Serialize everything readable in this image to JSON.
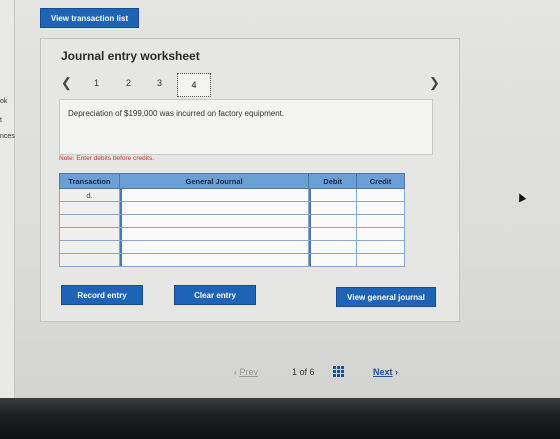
{
  "sidebar": {
    "fragments": [
      "ok",
      "t",
      "nces"
    ]
  },
  "toolbar": {
    "view_transactions_label": "View transaction list"
  },
  "worksheet": {
    "title": "Journal entry worksheet",
    "steps": [
      "1",
      "2",
      "3",
      "4"
    ],
    "active_step": "4",
    "prev_icon": "chevron-left",
    "next_icon": "chevron-right",
    "description": "Depreciation of $199,000 was incurred on factory equipment.",
    "note": "Note: Enter debits before credits.",
    "table": {
      "headers": [
        "Transaction",
        "General Journal",
        "Debit",
        "Credit"
      ],
      "rows": [
        {
          "transaction": "d."
        },
        {
          "transaction": ""
        },
        {
          "transaction": ""
        },
        {
          "transaction": ""
        },
        {
          "transaction": ""
        },
        {
          "transaction": ""
        }
      ]
    },
    "buttons": {
      "record": "Record entry",
      "clear": "Clear entry",
      "view_journal": "View general journal"
    }
  },
  "pagination": {
    "prev_label": "Prev",
    "page_text": "1 of 6",
    "next_label": "Next",
    "grid_icon": "grid-icon"
  },
  "colors": {
    "button_blue": "#1f63b6",
    "table_header": "#6c9fd6",
    "note_red": "#c0392b"
  }
}
